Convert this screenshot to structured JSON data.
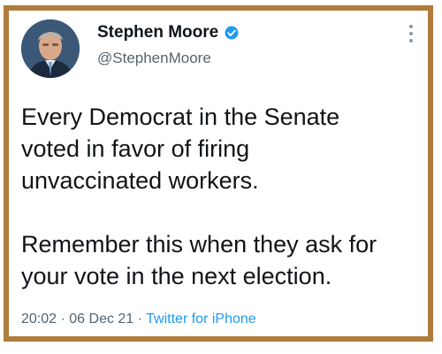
{
  "tweet": {
    "author": {
      "display_name": "Stephen Moore",
      "handle": "@StephenMoore",
      "verified": true,
      "verified_icon": "verified-badge-icon"
    },
    "menu_icon": "more-vertical-icon",
    "text_lines_1": [
      "Every Democrat in the Senate",
      "voted in favor of firing",
      "unvaccinated workers."
    ],
    "text_lines_2": [
      "Remember this when they ask for",
      "your vote in the next election."
    ],
    "time": "20:02",
    "separator": "·",
    "date": "06 Dec 21",
    "source": "Twitter for iPhone"
  },
  "colors": {
    "frame_border": "#b07c3c",
    "text": "#0f1419",
    "muted": "#536471",
    "accent": "#1d9bf0"
  }
}
